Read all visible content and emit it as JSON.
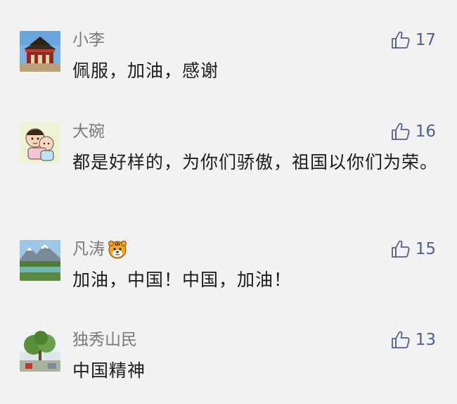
{
  "comments": [
    {
      "name": "小李",
      "text": "佩服，加油，感谢",
      "likes": "17",
      "avatar_icon": "avatar-temple",
      "name_emoji": ""
    },
    {
      "name": "大碗",
      "text": "都是好样的，为你们骄傲，祖国以你们为荣。",
      "likes": "16",
      "avatar_icon": "avatar-cartoon-kids",
      "name_emoji": ""
    },
    {
      "name": "凡涛",
      "text": "加油，中国！中国，加油！",
      "likes": "15",
      "avatar_icon": "avatar-mountain-lake",
      "name_emoji": "tiger-emoji"
    },
    {
      "name": "独秀山民",
      "text": "中国精神",
      "likes": "13",
      "avatar_icon": "avatar-tree-courtyard",
      "name_emoji": ""
    }
  ],
  "colors": {
    "background": "#f2f2f3",
    "name": "#7a7a7a",
    "text": "#1c1c1c",
    "like": "#50618f"
  }
}
